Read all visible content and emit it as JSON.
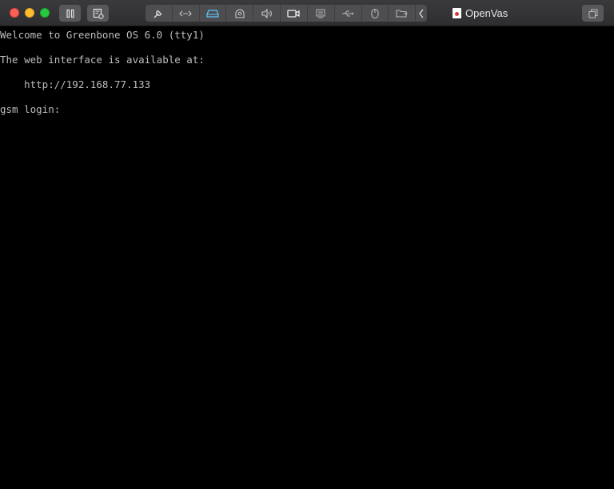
{
  "window": {
    "title": "OpenVas"
  },
  "toolbar": {
    "pause_icon": "pause-icon",
    "snapshot_icon": "snapshot-icon",
    "tools": [
      {
        "name": "settings-wrench-icon"
      },
      {
        "name": "network-arrows-icon"
      },
      {
        "name": "hard-disk-icon"
      },
      {
        "name": "camera-device-icon"
      },
      {
        "name": "sound-icon"
      },
      {
        "name": "video-capture-icon"
      },
      {
        "name": "printer-icon"
      },
      {
        "name": "usb-icon"
      },
      {
        "name": "mouse-icon"
      },
      {
        "name": "shared-folder-icon"
      },
      {
        "name": "collapse-chevron-icon"
      }
    ],
    "active_tool_color": "#5ac8fa"
  },
  "console": {
    "lines": [
      "Welcome to Greenbone OS 6.0 (tty1)",
      "The web interface is available at:",
      "    http://192.168.77.133",
      "gsm login:"
    ]
  }
}
